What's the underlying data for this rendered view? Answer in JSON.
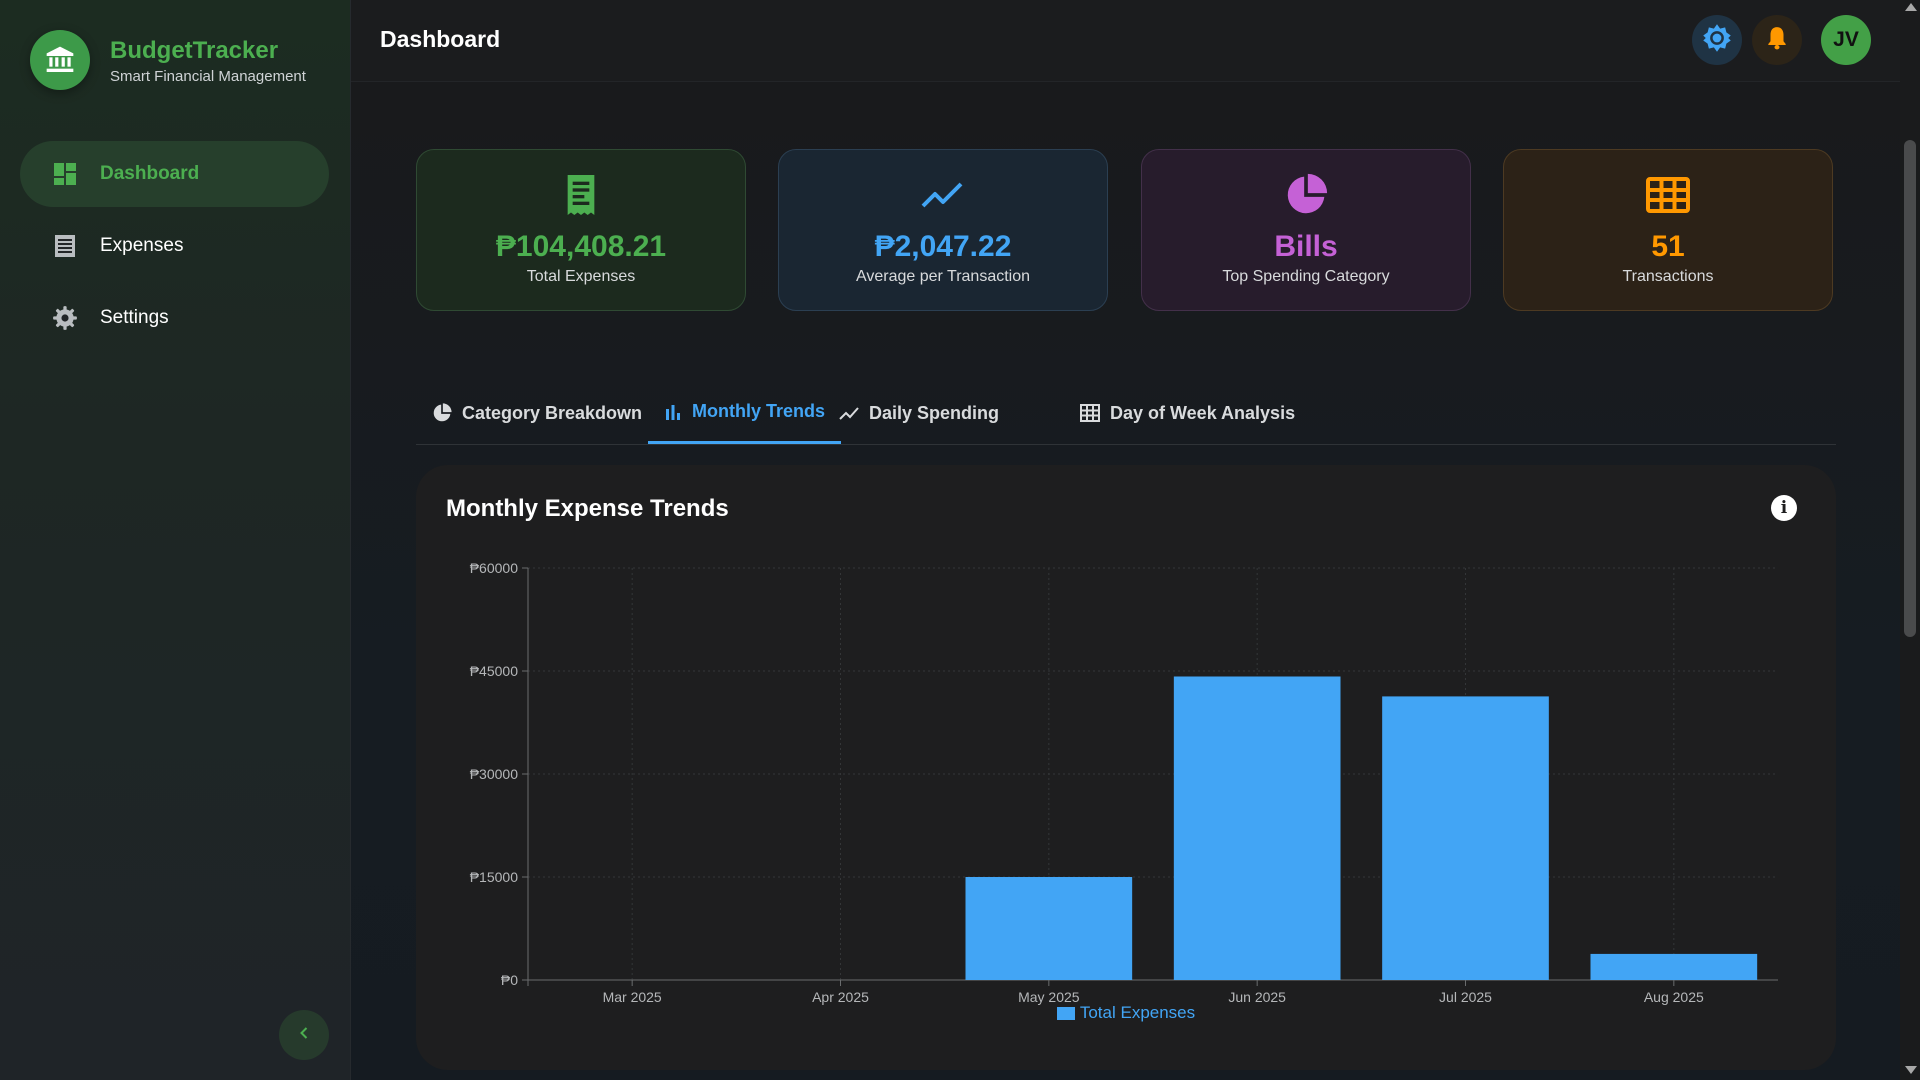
{
  "brand": {
    "title": "BudgetTracker",
    "subtitle": "Smart Financial Management",
    "logo_icon": "bank-icon"
  },
  "sidebar": {
    "items": [
      {
        "label": "Dashboard",
        "icon": "dashboard-icon",
        "active": true
      },
      {
        "label": "Expenses",
        "icon": "receipt-list-icon",
        "active": false
      },
      {
        "label": "Settings",
        "icon": "gear-icon",
        "active": false
      }
    ],
    "collapse_icon": "chevron-left-icon"
  },
  "header": {
    "title": "Dashboard",
    "theme_icon": "brightness-icon",
    "notification_icon": "bell-icon",
    "avatar_initials": "JV"
  },
  "stats": [
    {
      "value": "₱104,408.21",
      "label": "Total Expenses",
      "icon": "receipt-icon",
      "color": "#4caf50"
    },
    {
      "value": "₱2,047.22",
      "label": "Average per Transaction",
      "icon": "trending-icon",
      "color": "#42a5f5"
    },
    {
      "value": "Bills",
      "label": "Top Spending Category",
      "icon": "pie-chart-icon",
      "color": "#c561d6"
    },
    {
      "value": "51",
      "label": "Transactions",
      "icon": "grid-table-icon",
      "color": "#ff9800"
    }
  ],
  "tabs": [
    {
      "label": "Category Breakdown",
      "icon": "pie-chart-icon",
      "active": false
    },
    {
      "label": "Monthly Trends",
      "icon": "bar-chart-icon",
      "active": true
    },
    {
      "label": "Daily Spending",
      "icon": "trend-line-icon",
      "active": false
    },
    {
      "label": "Day of Week Analysis",
      "icon": "grid-table-icon",
      "active": false
    }
  ],
  "chart_panel": {
    "title": "Monthly Expense Trends",
    "info_icon": "info-icon"
  },
  "colors": {
    "accent_green": "#4caf50",
    "accent_blue": "#42a5f5",
    "accent_purple": "#c561d6",
    "accent_orange": "#ff9800"
  },
  "chart_data": {
    "type": "bar",
    "categories": [
      "Mar 2025",
      "Apr 2025",
      "May 2025",
      "Jun 2025",
      "Jul 2025",
      "Aug 2025"
    ],
    "series": [
      {
        "name": "Total Expenses",
        "values": [
          0,
          0,
          15000,
          44200,
          41300,
          3800
        ],
        "color": "#42a5f5"
      }
    ],
    "y_ticks": [
      "₱0",
      "₱15000",
      "₱30000",
      "₱45000",
      "₱60000"
    ],
    "ylim": [
      0,
      60000
    ],
    "grid": true,
    "legend_position": "bottom"
  }
}
